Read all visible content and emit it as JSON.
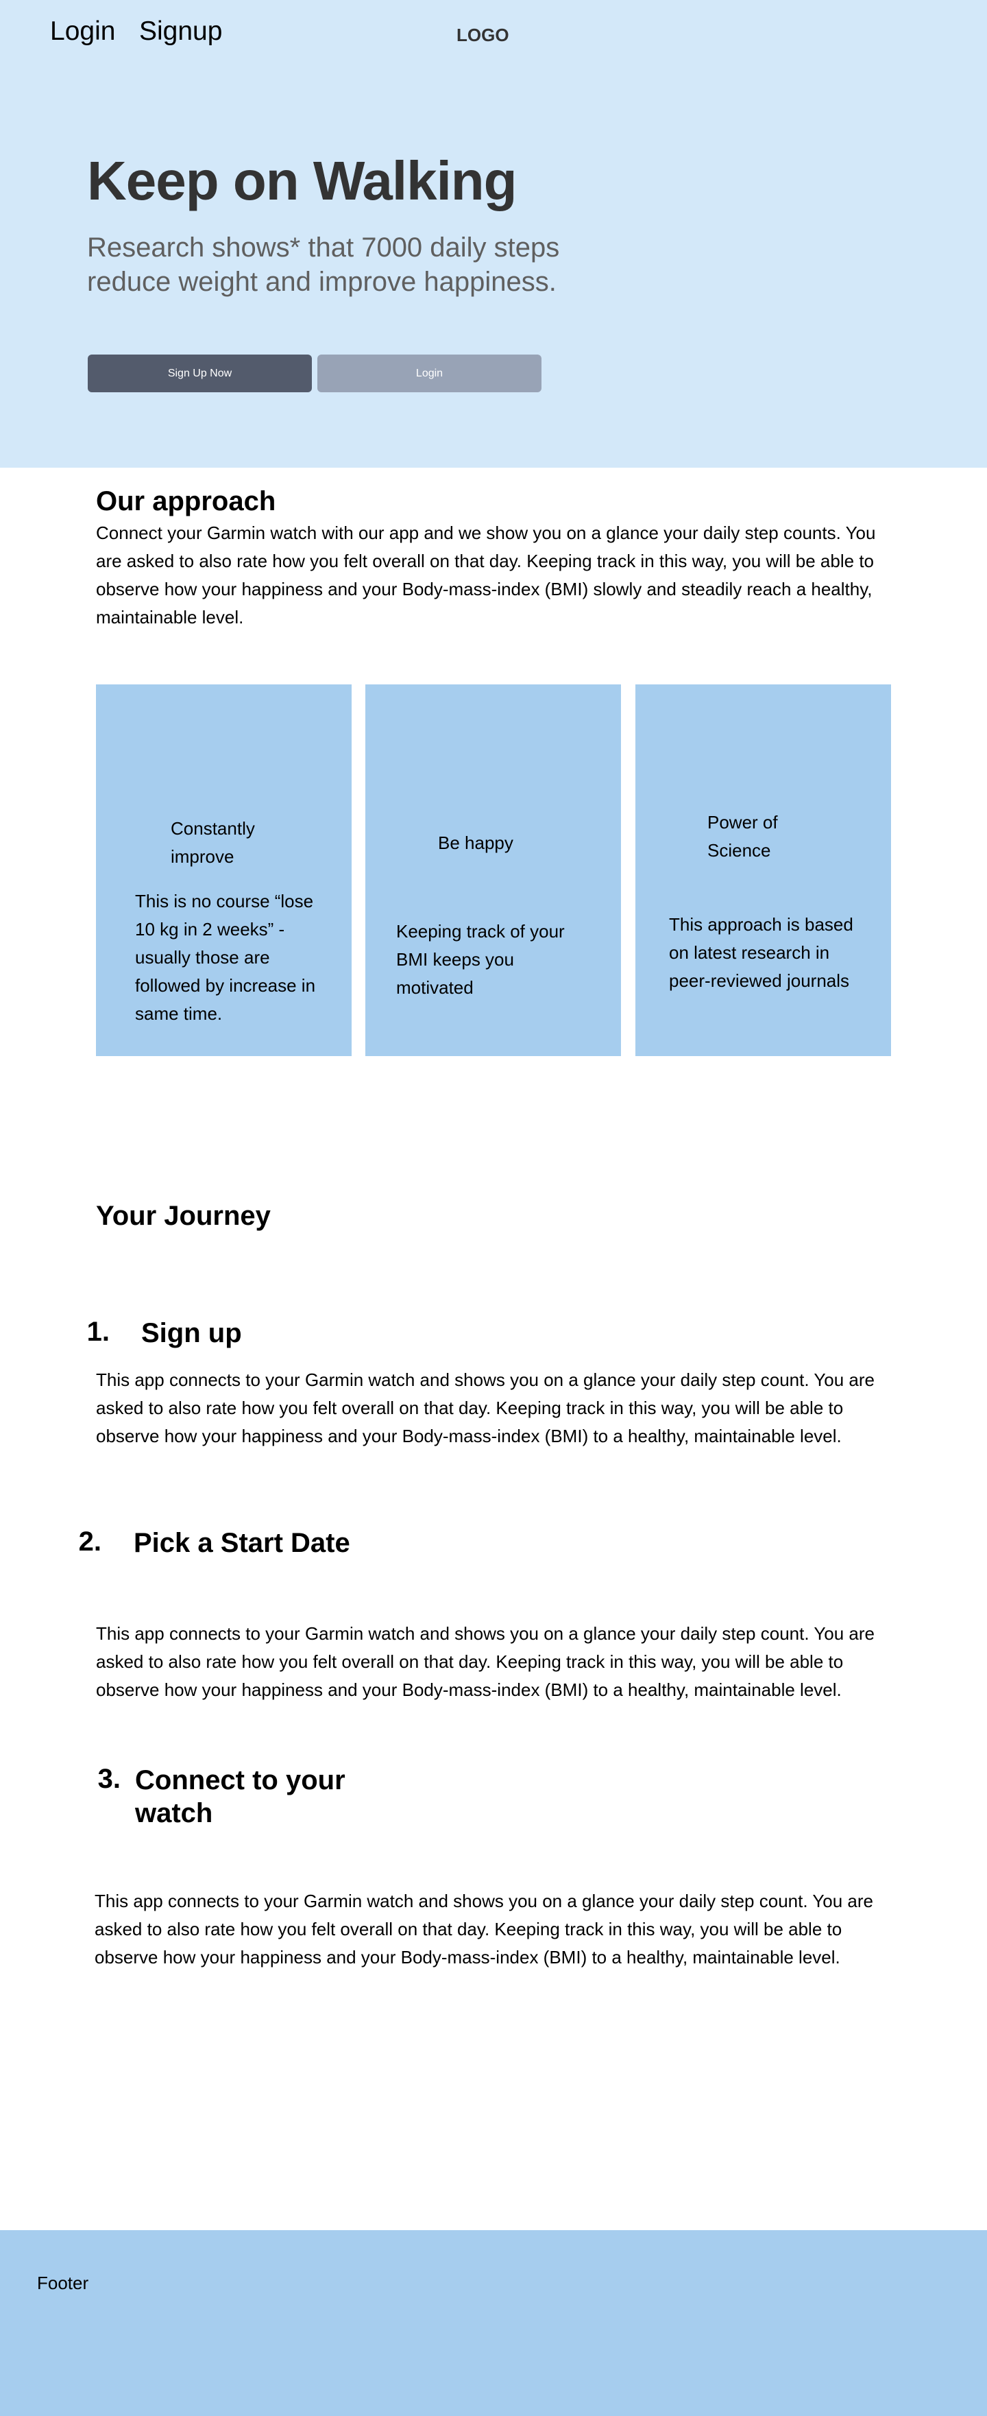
{
  "nav": {
    "login_label": "Login",
    "signup_label": "Signup",
    "logo": "LOGO"
  },
  "hero": {
    "title": "Keep on Walking",
    "subtitle": "Research shows* that 7000 daily steps reduce weight and improve happiness.",
    "primary_button": "Sign Up Now",
    "secondary_button": "Login"
  },
  "approach": {
    "title": "Our approach",
    "text": "Connect your Garmin watch with our app and we show you on a glance your daily step counts. You are asked to also rate how you felt overall on that day. Keeping track in this way, you will be able to observe how your happiness and your Body-mass-index (BMI) slowly and steadily reach a healthy, maintainable level.",
    "cards": [
      {
        "heading": "Constantly improve",
        "text": "This is no course “lose 10 kg in 2 weeks” - usually those are followed by increase in same time."
      },
      {
        "heading": "Be happy",
        "text": "Keeping track of your BMI keeps you motivated"
      },
      {
        "heading": "Power of Science",
        "text": "This approach is based on latest research in peer-reviewed journals"
      }
    ]
  },
  "journey": {
    "title": "Your Journey",
    "steps": [
      {
        "number": "1.",
        "title": "Sign up",
        "text": "This app connects to your Garmin watch and shows you on a glance your daily step count. You are asked to also rate how you felt overall on that day. Keeping track in this way, you will be able to observe how your happiness and your Body-mass-index (BMI) to a healthy, maintainable level."
      },
      {
        "number": "2.",
        "title": "Pick a Start Date",
        "text": "This app connects to your Garmin watch and shows you on a glance your daily step count. You are asked to also rate how you felt overall on that day. Keeping track in this way, you will be able to observe how your happiness and your Body-mass-index (BMI) to a healthy, maintainable level."
      },
      {
        "number": "3.",
        "title": "Connect to your watch",
        "text": "This app connects to your Garmin watch and shows you on a glance your daily step count. You are asked to also rate how you felt overall on that day. Keeping track in this way, you will be able to observe how your happiness and your Body-mass-index (BMI) to a healthy, maintainable level."
      }
    ]
  },
  "footer": {
    "text": "Footer"
  },
  "colors": {
    "hero_bg": "#d3e8f9",
    "card_bg": "#a6cdee",
    "footer_bg": "#a6cdee",
    "primary_button": "#535b6c",
    "secondary_button": "#98a3b6",
    "heading_dark": "#333333",
    "subtitle_gray": "#5f5f5f"
  }
}
